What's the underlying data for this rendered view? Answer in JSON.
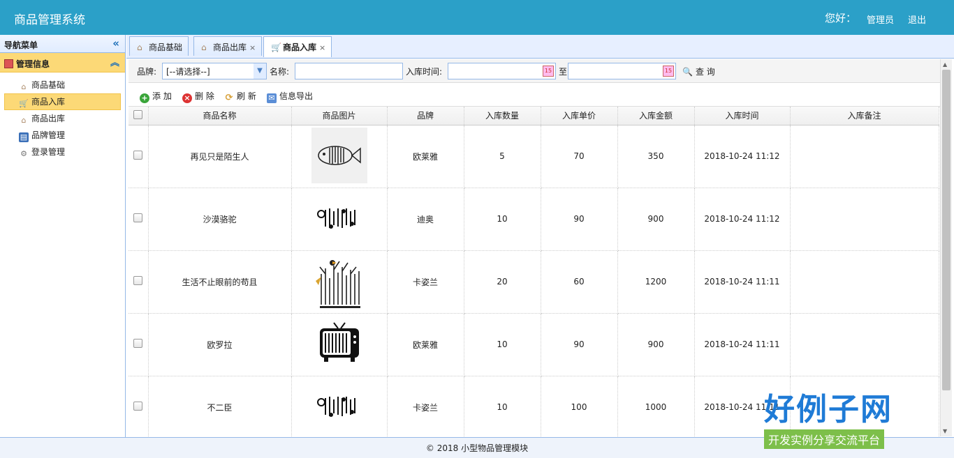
{
  "header": {
    "title": "商品管理系统",
    "greeting": "您好：",
    "user": "管理员",
    "logout": "退出"
  },
  "sidebar": {
    "nav_title": "导航菜单",
    "group": "管理信息",
    "items": [
      {
        "label": "商品基础",
        "icon": "home-icon"
      },
      {
        "label": "商品入库",
        "icon": "cart-icon",
        "active": true
      },
      {
        "label": "商品出库",
        "icon": "home-icon"
      },
      {
        "label": "品牌管理",
        "icon": "book-icon"
      },
      {
        "label": "登录管理",
        "icon": "gear-icon"
      }
    ]
  },
  "tabs": [
    {
      "label": "商品基础"
    },
    {
      "label": "商品出库"
    },
    {
      "label": "商品入库",
      "active": true
    }
  ],
  "search": {
    "brand_label": "品牌:",
    "brand_value": "[--请选择--]",
    "name_label": "名称:",
    "time_label": "入库时间:",
    "to_label": "至",
    "query": "查 询"
  },
  "toolbar": {
    "add": "添 加",
    "delete": "删 除",
    "refresh": "刷 新",
    "export": "信息导出"
  },
  "table": {
    "columns": [
      "商品名称",
      "商品图片",
      "品牌",
      "入库数量",
      "入库单价",
      "入库金额",
      "入库时间",
      "入库备注"
    ],
    "rows": [
      {
        "name": "再见只是陌生人",
        "image": "fish-barcode",
        "brand": "欧莱雅",
        "qty": "5",
        "price": "70",
        "amount": "350",
        "time": "2018-10-24 11:12",
        "note": ""
      },
      {
        "name": "沙漠骆驼",
        "image": "music-barcode",
        "brand": "迪奥",
        "qty": "10",
        "price": "90",
        "amount": "900",
        "time": "2018-10-24 11:12",
        "note": ""
      },
      {
        "name": "生活不止眼前的苟且",
        "image": "tree-barcode",
        "brand": "卡姿兰",
        "qty": "20",
        "price": "60",
        "amount": "1200",
        "time": "2018-10-24 11:11",
        "note": ""
      },
      {
        "name": "欧罗拉",
        "image": "tv-barcode",
        "brand": "欧莱雅",
        "qty": "10",
        "price": "90",
        "amount": "900",
        "time": "2018-10-24 11:11",
        "note": ""
      },
      {
        "name": "不二臣",
        "image": "music-barcode",
        "brand": "卡姿兰",
        "qty": "10",
        "price": "100",
        "amount": "1000",
        "time": "2018-10-24 11:11",
        "note": ""
      }
    ]
  },
  "footer": "© 2018 小型物品管理模块",
  "logo": {
    "big": "好例子网",
    "small": "开发实例分享交流平台"
  }
}
